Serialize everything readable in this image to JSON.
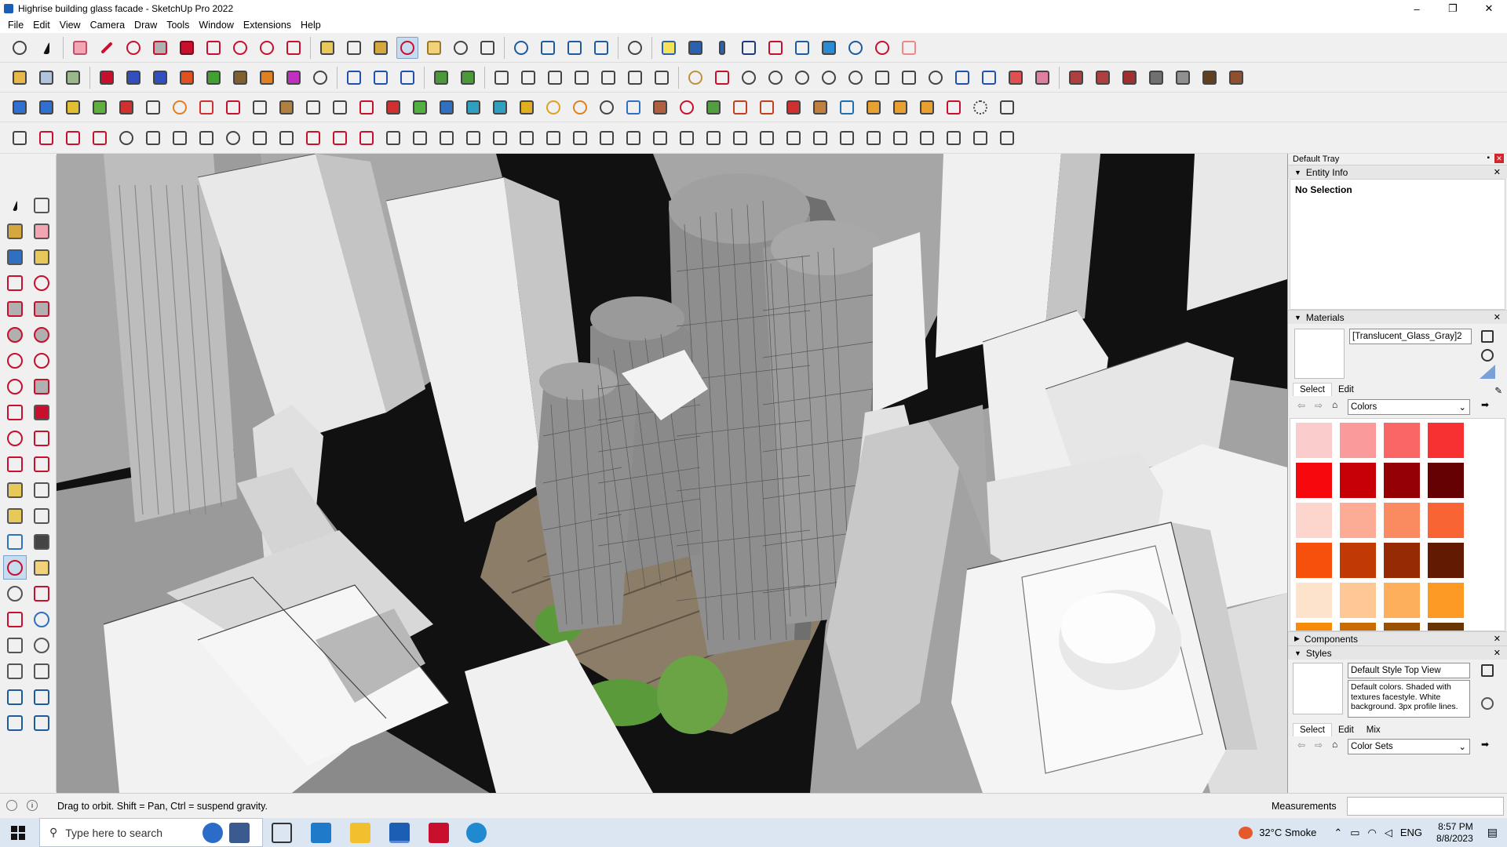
{
  "window": {
    "title": "Highrise building glass facade - SketchUp Pro 2022",
    "minimize": "–",
    "maximize": "❐",
    "close": "✕"
  },
  "menu": [
    "File",
    "Edit",
    "View",
    "Camera",
    "Draw",
    "Tools",
    "Window",
    "Extensions",
    "Help"
  ],
  "status": {
    "hint": "Drag to orbit. Shift = Pan, Ctrl = suspend gravity.",
    "measurements_label": "Measurements"
  },
  "tray": {
    "title": "Default Tray",
    "entity_info": {
      "header": "Entity Info",
      "value": "No Selection"
    },
    "materials": {
      "header": "Materials",
      "name": "[Translucent_Glass_Gray]2",
      "tab_select": "Select",
      "tab_edit": "Edit",
      "library": "Colors",
      "swatches": [
        "#fbcccc",
        "#fa9a9a",
        "#fa6565",
        "#f73131",
        "#f7080c",
        "#c60006",
        "#950005",
        "#650003",
        "#fcd6cc",
        "#fcab94",
        "#fa8a5f",
        "#f86434",
        "#f7500d",
        "#c23a03",
        "#962a04",
        "#631a02",
        "#fde3cc",
        "#fdc796",
        "#feaf5b",
        "#fd9925",
        "#f88a0a",
        "#c96c05",
        "#9a5103",
        "#683503"
      ]
    },
    "components": {
      "header": "Components"
    },
    "styles": {
      "header": "Styles",
      "name": "Default Style Top View",
      "description": "Default colors. Shaded with textures facestyle. White background. 3px profile lines.",
      "tab_select": "Select",
      "tab_edit": "Edit",
      "tab_mix": "Mix",
      "library": "Color Sets"
    }
  },
  "taskbar": {
    "search_placeholder": "Type here to search",
    "weather": "32°C  Smoke",
    "language": "ENG",
    "time": "8:57 PM",
    "date": "8/8/2023"
  },
  "colors": {
    "accent": "#1a5fb4",
    "orbit_active": "#c8dcf0",
    "background": "#111111"
  }
}
